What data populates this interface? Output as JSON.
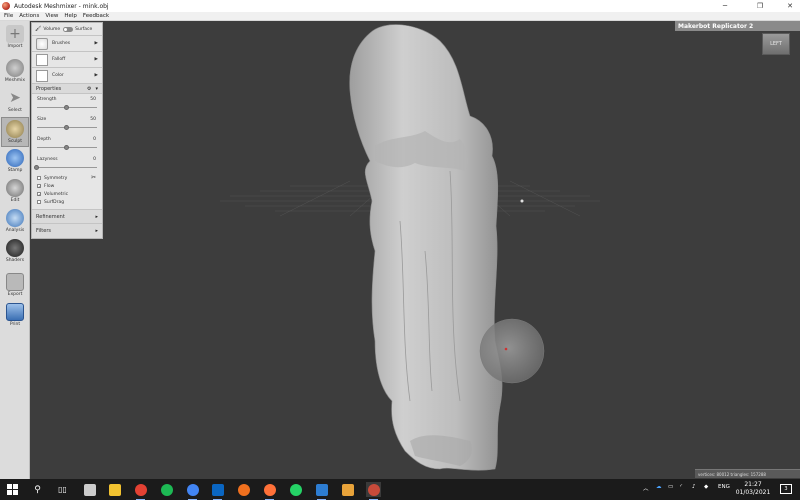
{
  "window": {
    "title": "Autodesk Meshmixer - mink.obj",
    "min": "─",
    "max": "❐",
    "close": "✕"
  },
  "menu": [
    "File",
    "Actions",
    "View",
    "Help",
    "Feedback"
  ],
  "tools": [
    {
      "label": "Import",
      "icon": "plus-icon",
      "color": "#c8c8c8"
    },
    {
      "label": "Meshmix",
      "icon": "meshmix-icon",
      "color": "#9a9a9a"
    },
    {
      "label": "Select",
      "icon": "select-arrow-icon",
      "color": "#a8a8a8"
    },
    {
      "label": "Sculpt",
      "icon": "brush-icon",
      "color": "#c9a24a"
    },
    {
      "label": "Stamp",
      "icon": "stamp-icon",
      "color": "#3a7bd5"
    },
    {
      "label": "Edit",
      "icon": "edit-sphere-icon",
      "color": "#8a8a8a"
    },
    {
      "label": "Analysis",
      "icon": "analysis-icon",
      "color": "#4a86c8"
    },
    {
      "label": "Shaders",
      "icon": "shader-sphere-icon",
      "color": "#2f2f2f"
    },
    {
      "label": "Export",
      "icon": "export-icon",
      "color": "#9a9a9a"
    },
    {
      "label": "Print",
      "icon": "print-icon",
      "color": "#5b8fc9"
    }
  ],
  "sculpt": {
    "mode_volume": "Volume",
    "mode_surface": "Surface",
    "brushes": [
      {
        "label": "Brushes",
        "arrow": "▶"
      },
      {
        "label": "Falloff",
        "arrow": "▶"
      },
      {
        "label": "Color",
        "arrow": "▶"
      }
    ],
    "properties_title": "Properties",
    "sliders": [
      {
        "label": "Strength",
        "value": "50",
        "fraction": 0.5
      },
      {
        "label": "Size",
        "value": "50",
        "fraction": 0.5
      },
      {
        "label": "Depth",
        "value": "0",
        "fraction": 0.5
      },
      {
        "label": "Lazyness",
        "value": "0",
        "fraction": 0.0
      }
    ],
    "checkboxes": [
      {
        "label": "Symmetry",
        "checked": false
      },
      {
        "label": "Flow",
        "checked": true
      },
      {
        "label": "Volumetric",
        "checked": true
      },
      {
        "label": "SurfDrag",
        "checked": false
      }
    ],
    "refinement_title": "Refinement",
    "filters_title": "Filters"
  },
  "printer": {
    "name": "Makerbot Replicator 2"
  },
  "viewcube": {
    "label": "LEFT"
  },
  "status": {
    "text": "vertices: 80012 triangles: 157288"
  },
  "taskbar": {
    "apps": [
      {
        "name": "start-icon",
        "color": "#ffffff"
      },
      {
        "name": "search-icon",
        "color": "#ffffff"
      },
      {
        "name": "task-view-icon",
        "color": "#ffffff"
      },
      {
        "name": "cube-app-icon",
        "color": "#cccccc"
      },
      {
        "name": "file-explorer-icon",
        "color": "#f2c230"
      },
      {
        "name": "chrome-icon",
        "color": "#e34133"
      },
      {
        "name": "spotify-icon",
        "color": "#1db954"
      },
      {
        "name": "chrome-user-icon",
        "color": "#4285f4"
      },
      {
        "name": "outlook-icon",
        "color": "#0a66c2"
      },
      {
        "name": "app-orange-icon",
        "color": "#f0701e"
      },
      {
        "name": "firefox-icon",
        "color": "#ff7139"
      },
      {
        "name": "whatsapp-icon",
        "color": "#25d366"
      },
      {
        "name": "photos-icon",
        "color": "#2d7dd2"
      },
      {
        "name": "notes-icon",
        "color": "#e8a33a"
      },
      {
        "name": "meshmixer-taskbar-icon",
        "color": "#c74a3a"
      }
    ],
    "tray_lang": "ENG",
    "time": "21:27",
    "date": "01/03/2021",
    "notifications": "3"
  },
  "colors": {
    "viewport": "#3d3d3d",
    "mesh": "#c4c4c4",
    "brush_sphere": "#8a8a8a",
    "panel": "#e6e6e6"
  }
}
